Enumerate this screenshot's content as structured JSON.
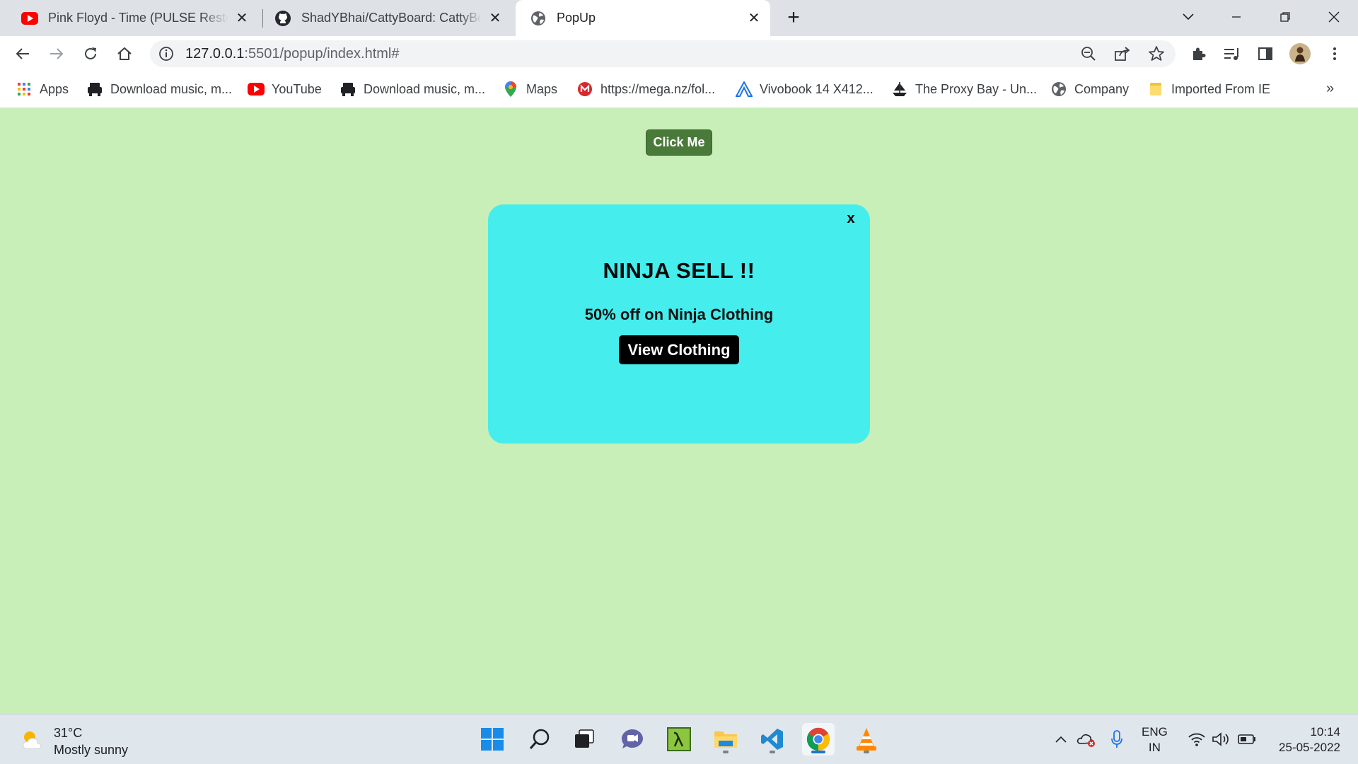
{
  "browser": {
    "tabs": [
      {
        "title": "Pink Floyd - Time (PULSE Restore",
        "icon": "youtube-icon",
        "active": false
      },
      {
        "title": "ShadYBhai/CattyBoard: CattyBoa",
        "icon": "github-icon",
        "active": false
      },
      {
        "title": "PopUp",
        "icon": "globe-icon",
        "active": true
      }
    ],
    "close_glyph": "✕",
    "new_tab_glyph": "+",
    "url_host": "127.0.0.1",
    "url_rest": ":5501/popup/index.html#",
    "bookmarks": [
      {
        "label": "Apps",
        "icon": "apps-grid-icon"
      },
      {
        "label": "Download music, m...",
        "icon": "music-download-icon"
      },
      {
        "label": "YouTube",
        "icon": "youtube-icon"
      },
      {
        "label": "Download music, m...",
        "icon": "music-download-icon"
      },
      {
        "label": "Maps",
        "icon": "maps-pin-icon"
      },
      {
        "label": "https://mega.nz/fol...",
        "icon": "mega-icon"
      },
      {
        "label": "Vivobook 14 X412...",
        "icon": "asus-icon"
      },
      {
        "label": "The Proxy Bay - Un...",
        "icon": "pirate-ship-icon"
      },
      {
        "label": "Company",
        "icon": "globe-icon"
      },
      {
        "label": "Imported From IE",
        "icon": "folder-icon"
      }
    ],
    "bookmarks_more": "»"
  },
  "page": {
    "button_label": "Click Me",
    "popup": {
      "close_label": "x",
      "title": "NINJA SELL !!",
      "subtitle": "50% off on Ninja Clothing",
      "cta_label": "View Clothing"
    }
  },
  "taskbar": {
    "weather_temp": "31°C",
    "weather_desc": "Mostly sunny",
    "apps": [
      "windows-start-icon",
      "search-icon",
      "task-view-icon",
      "teams-chat-icon",
      "lambda-app-icon",
      "file-explorer-icon",
      "vscode-icon",
      "chrome-icon",
      "vlc-icon"
    ],
    "lang_line1": "ENG",
    "lang_line2": "IN",
    "time": "10:14",
    "date": "25-05-2022"
  },
  "colors": {
    "page_bg": "#c8efb8",
    "button_bg": "#4a7a3a",
    "popup_bg": "#45eded",
    "cta_bg": "#000000"
  }
}
